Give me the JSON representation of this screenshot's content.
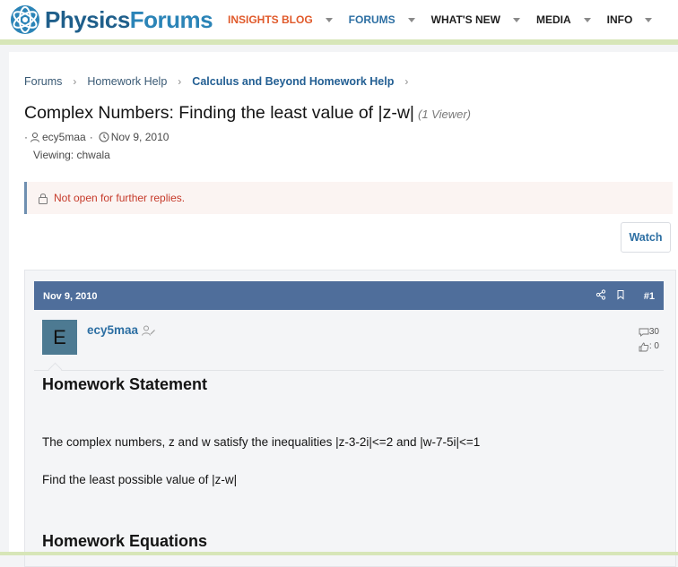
{
  "brand": {
    "name_part1": "Physics",
    "name_part2": "Forums",
    "accent": "#2b84b7",
    "dark": "#1f5f8b"
  },
  "nav": [
    {
      "label": "INSIGHTS BLOG"
    },
    {
      "label": "FORUMS"
    },
    {
      "label": "WHAT'S NEW"
    },
    {
      "label": "MEDIA"
    },
    {
      "label": "INFO"
    }
  ],
  "breadcrumb": [
    "Forums",
    "Homework Help",
    "Calculus and Beyond Homework Help"
  ],
  "thread": {
    "title": "Complex Numbers: Finding the least value of |z-w|",
    "viewer_note": "(1 Viewer)",
    "author": "ecy5maa",
    "date": "Nov 9, 2010",
    "viewing": "Viewing: chwala"
  },
  "notice": {
    "text": "Not open for further replies."
  },
  "watch_label": "Watch",
  "post": {
    "date": "Nov 9, 2010",
    "number": "#1",
    "avatar_letter": "E",
    "username": "ecy5maa",
    "messages": "30",
    "reactions": ": 0",
    "heading1": "Homework Statement",
    "text1": "The complex numbers, z and w satisfy the inequalities |z-3-2i|<=2 and |w-7-5i|<=1",
    "text2": "Find the least possible value of |z-w|",
    "heading2": "Homework Equations"
  }
}
